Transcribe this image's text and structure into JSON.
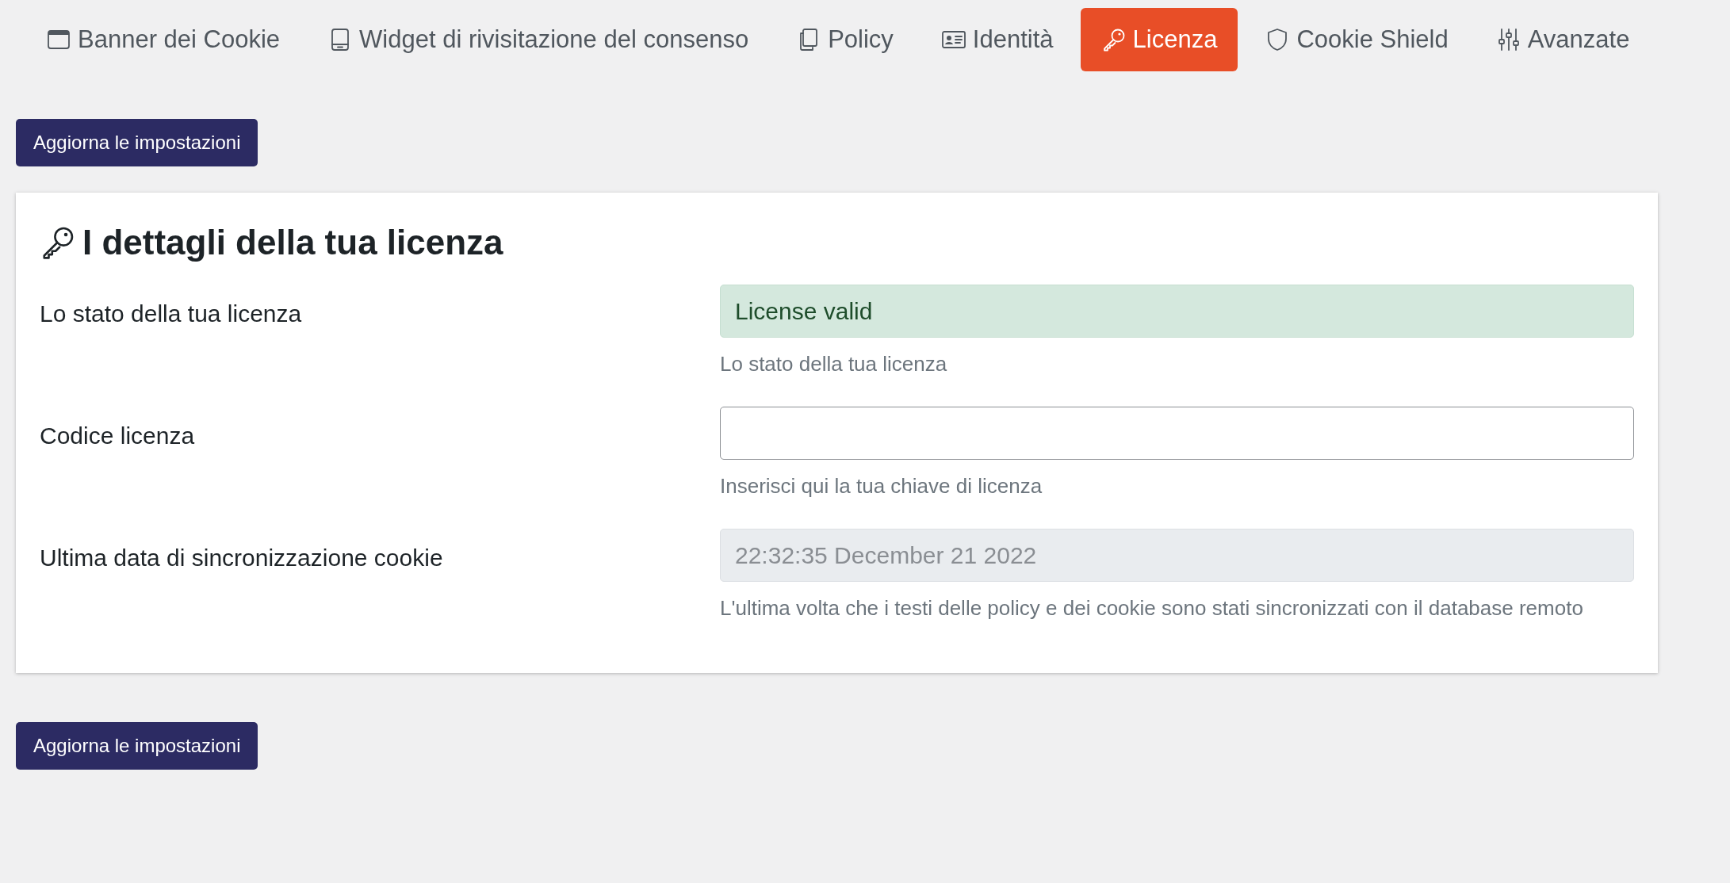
{
  "tabs": [
    {
      "label": "Banner dei Cookie",
      "kind": "banner",
      "selected": false
    },
    {
      "label": "Widget di rivisitazione del consenso",
      "kind": "tablet",
      "selected": false
    },
    {
      "label": "Policy",
      "kind": "documents",
      "selected": false
    },
    {
      "label": "Identità",
      "kind": "idcard",
      "selected": false
    },
    {
      "label": "Licenza",
      "kind": "key",
      "selected": true
    },
    {
      "label": "Cookie Shield",
      "kind": "shield",
      "selected": false
    },
    {
      "label": "Avanzate",
      "kind": "sliders",
      "selected": false
    }
  ],
  "top_button": "Aggiorna le impostazioni",
  "card": {
    "title": "I dettagli della tua licenza",
    "rows": [
      {
        "label": "Lo stato della tua licenza",
        "kind": "status",
        "value": "License valid",
        "help": "Lo stato della tua licenza"
      },
      {
        "label": "Codice licenza",
        "kind": "input",
        "help": "Inserisci qui la tua chiave di licenza"
      },
      {
        "label": "Ultima data di sincronizzazione cookie",
        "kind": "readonly",
        "value": "22:32:35 December 21 2022",
        "help": "L'ultima volta che i testi delle policy e dei cookie sono stati sincronizzati con il database remoto"
      }
    ]
  },
  "bottom_button": "Aggiorna le impostazioni"
}
